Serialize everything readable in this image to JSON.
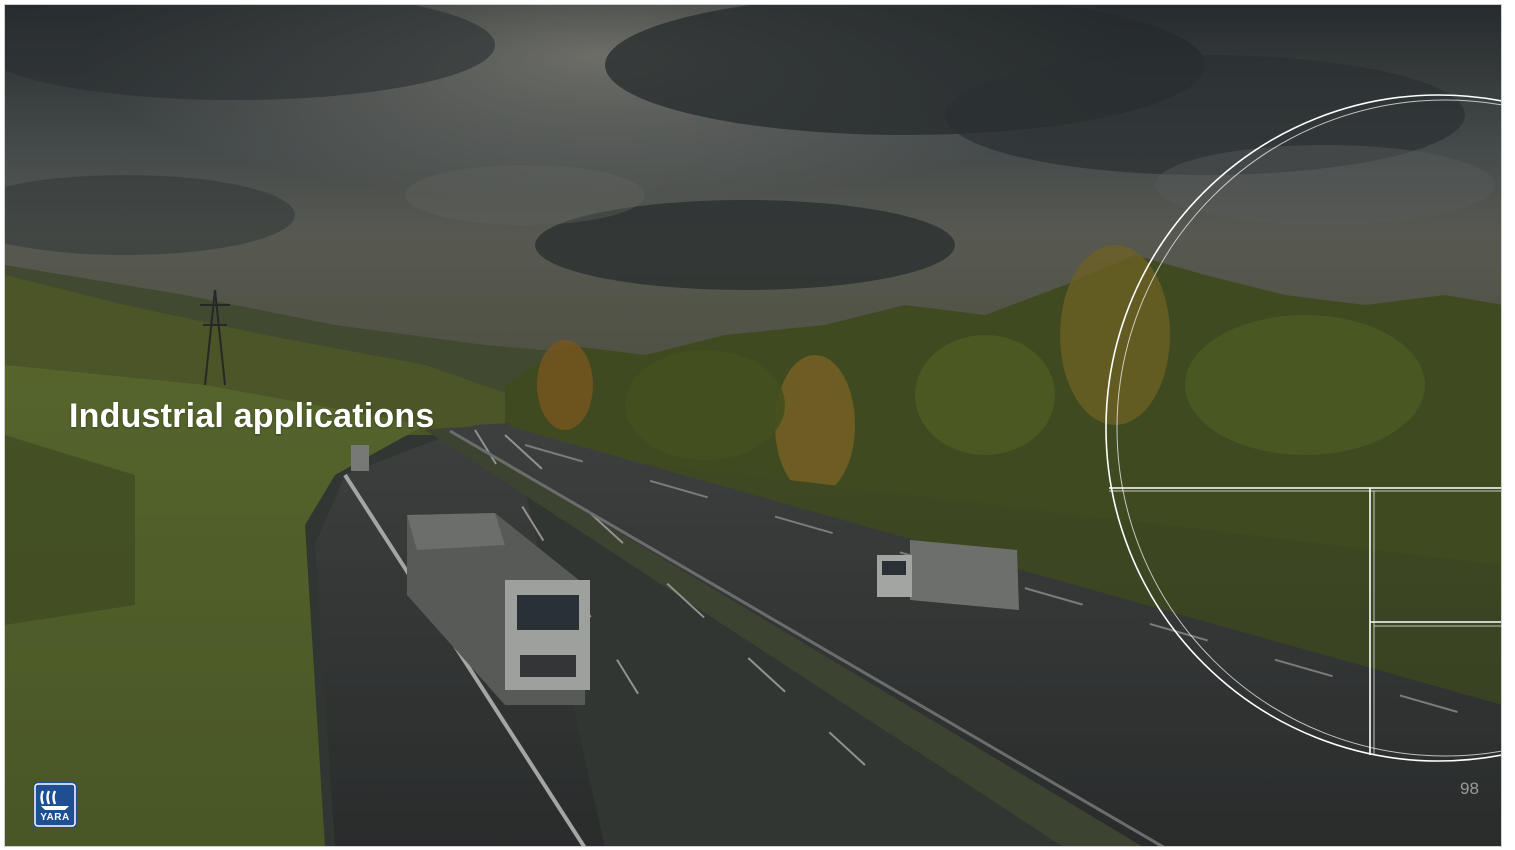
{
  "slide": {
    "title": "Industrial applications",
    "page_number": "98"
  },
  "logo": {
    "text": "YARA",
    "color": "#1d4f91"
  },
  "background": {
    "icon": "highway-landscape-photo",
    "sky_color": "#4a5256",
    "grass_color": "#6f8a3a",
    "road_color": "#3a3c3d",
    "tree_colors": [
      "#6d7a2a",
      "#8a7a23",
      "#556b23",
      "#a06a1e"
    ]
  },
  "overlay": {
    "line_color": "#ffffff"
  }
}
